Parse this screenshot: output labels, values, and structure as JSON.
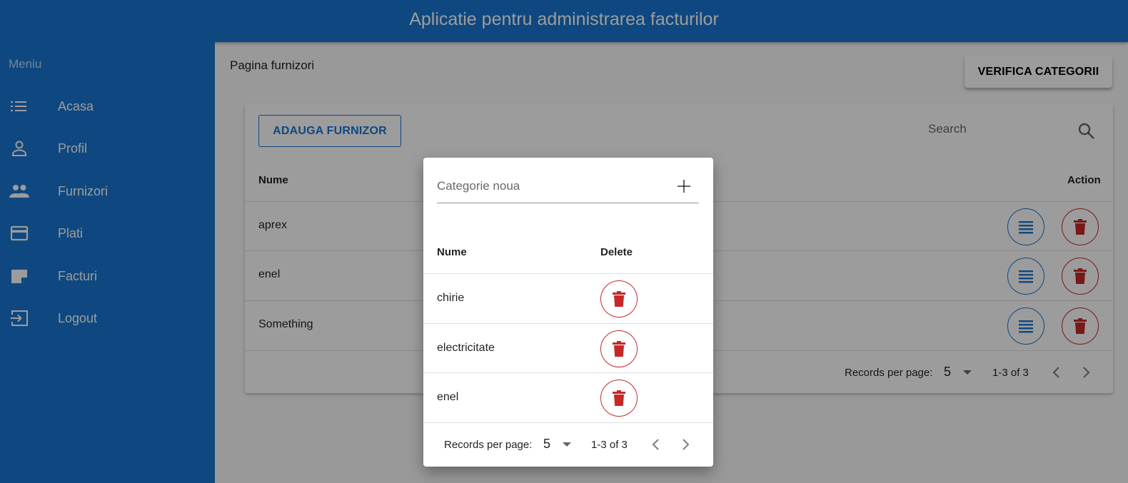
{
  "app": {
    "title": "Aplicatie pentru administrarea facturilor"
  },
  "sidebar": {
    "menu_title": "Meniu",
    "items": [
      {
        "label": "Acasa",
        "icon": "list-icon"
      },
      {
        "label": "Profil",
        "icon": "person-icon"
      },
      {
        "label": "Furnizori",
        "icon": "people-icon"
      },
      {
        "label": "Plati",
        "icon": "credit-card-icon"
      },
      {
        "label": "Facturi",
        "icon": "note-icon"
      },
      {
        "label": "Logout",
        "icon": "exit-icon"
      }
    ]
  },
  "page": {
    "title": "Pagina furnizori",
    "verifica_label": "VERIFICA CATEGORII",
    "adauga_label": "ADAUGA FURNIZOR",
    "search_placeholder": "Search",
    "table": {
      "headers": {
        "name": "Nume",
        "action": "Action"
      },
      "rows": [
        {
          "name": "aprex"
        },
        {
          "name": "enel"
        },
        {
          "name": "Something"
        }
      ]
    },
    "pagination": {
      "label": "Records per page:",
      "per_page": "5",
      "range": "1-3 of 3"
    }
  },
  "dialog": {
    "input_placeholder": "Categorie noua",
    "headers": {
      "name": "Nume",
      "delete": "Delete"
    },
    "rows": [
      {
        "name": "chirie"
      },
      {
        "name": "electricitate"
      },
      {
        "name": "enel"
      }
    ],
    "pagination": {
      "label": "Records per page:",
      "per_page": "5",
      "range": "1-3 of 3"
    }
  },
  "colors": {
    "primary": "#1976d2",
    "danger": "#c62828",
    "overlay": "rgba(0,0,0,0.39)"
  }
}
